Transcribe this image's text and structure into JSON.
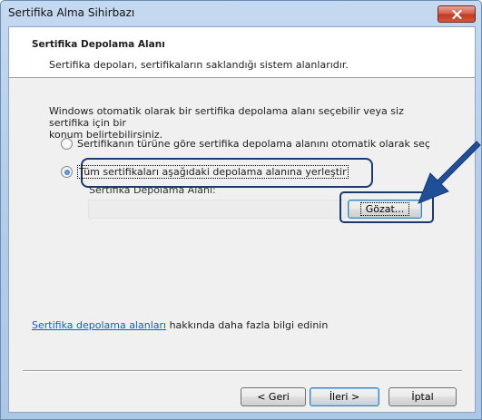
{
  "window": {
    "title": "Sertifika Alma Sihirbazı"
  },
  "header": {
    "title": "Sertifika Depolama Alanı",
    "description": "Sertifika depoları, sertifikaların saklandığı sistem alanlarıdır."
  },
  "intro": {
    "line1": "Windows otomatik olarak bir sertifika depolama alanı seçebilir veya siz sertifika için bir",
    "line2": "konum belirtebilirsiniz."
  },
  "options": [
    {
      "label": "Sertifikanın türüne göre sertifika depolama alanını otomatik olarak seç",
      "checked": false
    },
    {
      "label": "Tüm sertifikaları aşağıdaki depolama alanına yerleştir",
      "checked": true
    }
  ],
  "store": {
    "label": "Sertifika Depolama Alanı:",
    "value": "",
    "browse_label": "Gözat..."
  },
  "info": {
    "link_text": "Sertifika depolama alanları",
    "rest_text": " hakkında daha fazla bilgi edinin"
  },
  "buttons": {
    "back": "< Geri",
    "next": "İleri >",
    "cancel": "İptal"
  },
  "colors": {
    "highlight": "#1b3a6e",
    "arrow": "#1f4f99",
    "link": "#0066cc"
  }
}
